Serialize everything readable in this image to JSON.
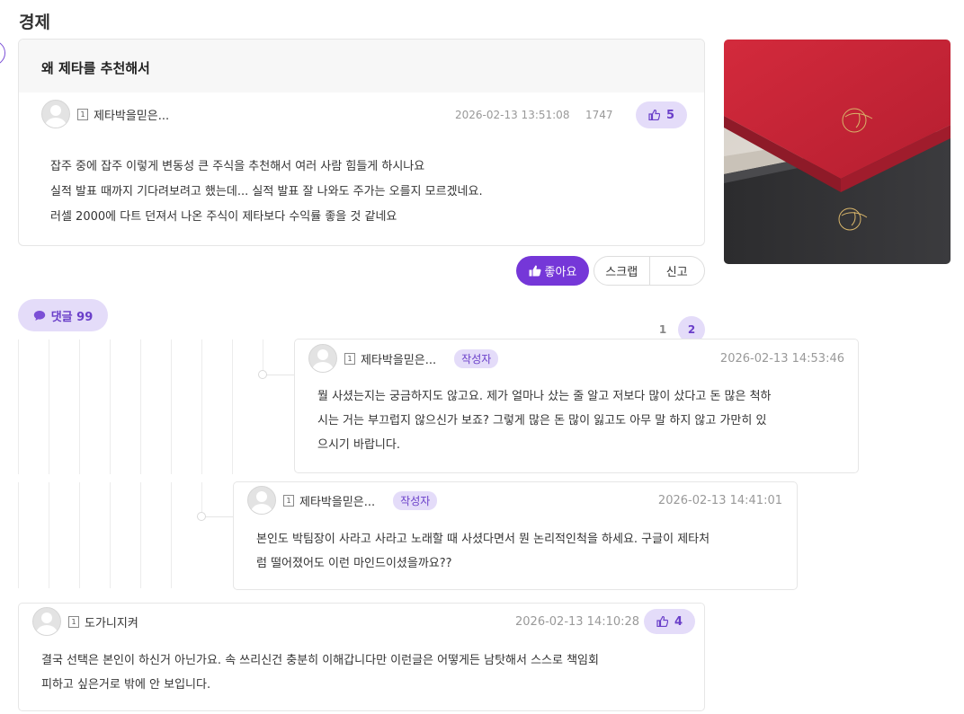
{
  "section": {
    "title": "경제"
  },
  "post": {
    "title": "왜 제타를 추천해서",
    "author": "제타박을믿은...",
    "level": "1",
    "datetime": "2026-02-13 13:51:08",
    "views": "1747",
    "likes": "5",
    "body": [
      "잡주 중에 잡주 이렇게 변동성 큰 주식을 추천해서 여러 사람 힘들게 하시나요",
      "실적 발표 때까지 기다려보려고 했는데... 실적 발표 잘 나와도 주가는 오를지 모르겠네요.",
      "러셀 2000에 다트 던져서 나온 주식이 제타보다 수익률 좋을 것 같네요"
    ]
  },
  "actions": {
    "like_label": "좋아요",
    "scrap_label": "스크랩",
    "report_label": "신고"
  },
  "comments_header": {
    "label": "댓글 99"
  },
  "pagination": {
    "pages": [
      "1",
      "2"
    ],
    "current": "2"
  },
  "comments": [
    {
      "author": "제타박을믿은...",
      "level": "1",
      "badge": "작성자",
      "datetime": "2026-02-13 14:53:46",
      "lines": [
        "뭘 사셨는지는 궁금하지도 않고요. 제가 얼마나 샀는 줄 알고 저보다 많이 샀다고 돈 많은 척하",
        "시는 거는 부끄럽지 않으신가 보죠? 그렇게 많은 돈 많이 잃고도 아무 말 하지 않고 가만히 있",
        "으시기 바랍니다."
      ]
    },
    {
      "author": "제타박을믿은...",
      "level": "1",
      "badge": "작성자",
      "datetime": "2026-02-13 14:41:01",
      "lines": [
        "본인도 박팀장이 사라고 사라고 노래할 때 사셨다면서 뭔 논리적인척을 하세요.  구글이 제타처",
        "럼 떨어졌어도 이런 마인드이셨을까요??"
      ]
    },
    {
      "author": "도가니지켜",
      "level": "1",
      "datetime": "2026-02-13 14:10:28",
      "likes": "4",
      "lines": [
        "결국 선택은 본인이 하신거 아닌가요. 속 쓰리신건 충분히 이해갑니다만 이런글은 어떻게든 남탓해서 스스로 책임회",
        "피하고 싶은거로 밖에 안 보입니다."
      ]
    }
  ],
  "icons": {
    "thumbs_up": "thumbs-up-icon",
    "comment": "speech-bubble-icon",
    "avatar": "default-avatar-icon",
    "level": "level-badge-icon"
  },
  "colors": {
    "accent": "#7537d8",
    "accent_soft": "#e4dcf9",
    "accent_text": "#6a3fc9"
  }
}
